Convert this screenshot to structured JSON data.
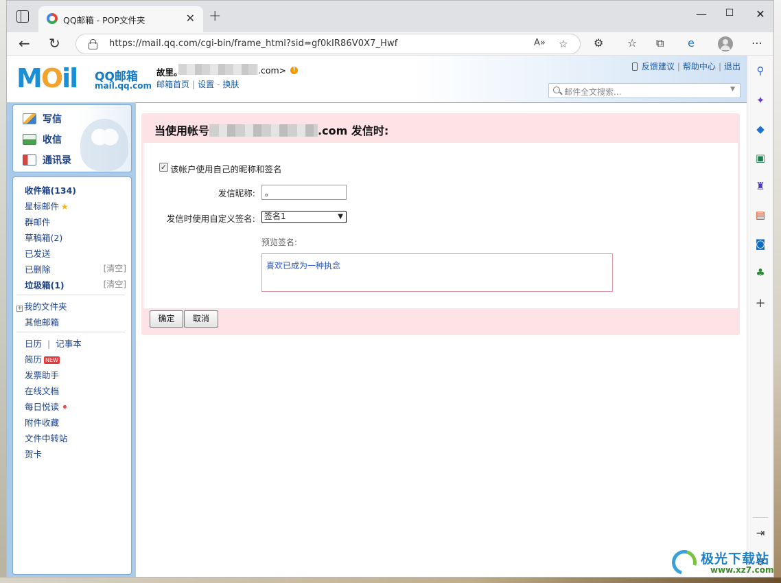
{
  "browser": {
    "tab_title": "QQ邮箱 - POP文件夹",
    "url": "https://mail.qq.com/cgi-bin/frame_html?sid=gf0kIR86V0X7_Hwf"
  },
  "header": {
    "logo_mark": "M",
    "logo_o": "O",
    "logo_rest": "il",
    "logo_text": "QQ邮箱",
    "logo_sub": "mail.qq.com",
    "user_prefix": "故里。",
    "user_suffix": ".com>",
    "links": [
      "邮箱首页",
      "设置",
      "换肤"
    ],
    "top_links": [
      "反馈建议",
      "帮助中心",
      "退出"
    ],
    "search_placeholder": "邮件全文搜索..."
  },
  "compose": {
    "items": [
      "写信",
      "收信",
      "通讯录"
    ]
  },
  "folders": {
    "inbox": "收件箱(134)",
    "starred": "星标邮件",
    "group": "群邮件",
    "drafts": "草稿箱(2)",
    "sent": "已发送",
    "deleted": "已删除",
    "spam": "垃圾箱(1)",
    "clear": "[清空]",
    "my_folders": "我的文件夹",
    "other_mail": "其他邮箱",
    "calendar": "日历",
    "notes": "记事本",
    "resume": "简历",
    "new_badge": "NEW",
    "invoice": "发票助手",
    "docs": "在线文档",
    "daily": "每日悦读",
    "attachments": "附件收藏",
    "transfer": "文件中转站",
    "card": "贺卡"
  },
  "form": {
    "title_prefix": "当使用帐号",
    "title_suffix": ".com 发信时:",
    "checkbox_label": "该帐户使用自己的昵称和签名",
    "checkbox_checked": true,
    "nickname_label": "发信昵称:",
    "nickname_value": "。",
    "signature_label": "发信时使用自定义签名:",
    "signature_selected": "签名1",
    "preview_label": "预览签名:",
    "preview_text": "喜欢已成为一种执念",
    "ok_button": "确定",
    "cancel_button": "取消"
  },
  "watermark": {
    "text": "极光下载站",
    "sub": "www.xz7.com"
  }
}
